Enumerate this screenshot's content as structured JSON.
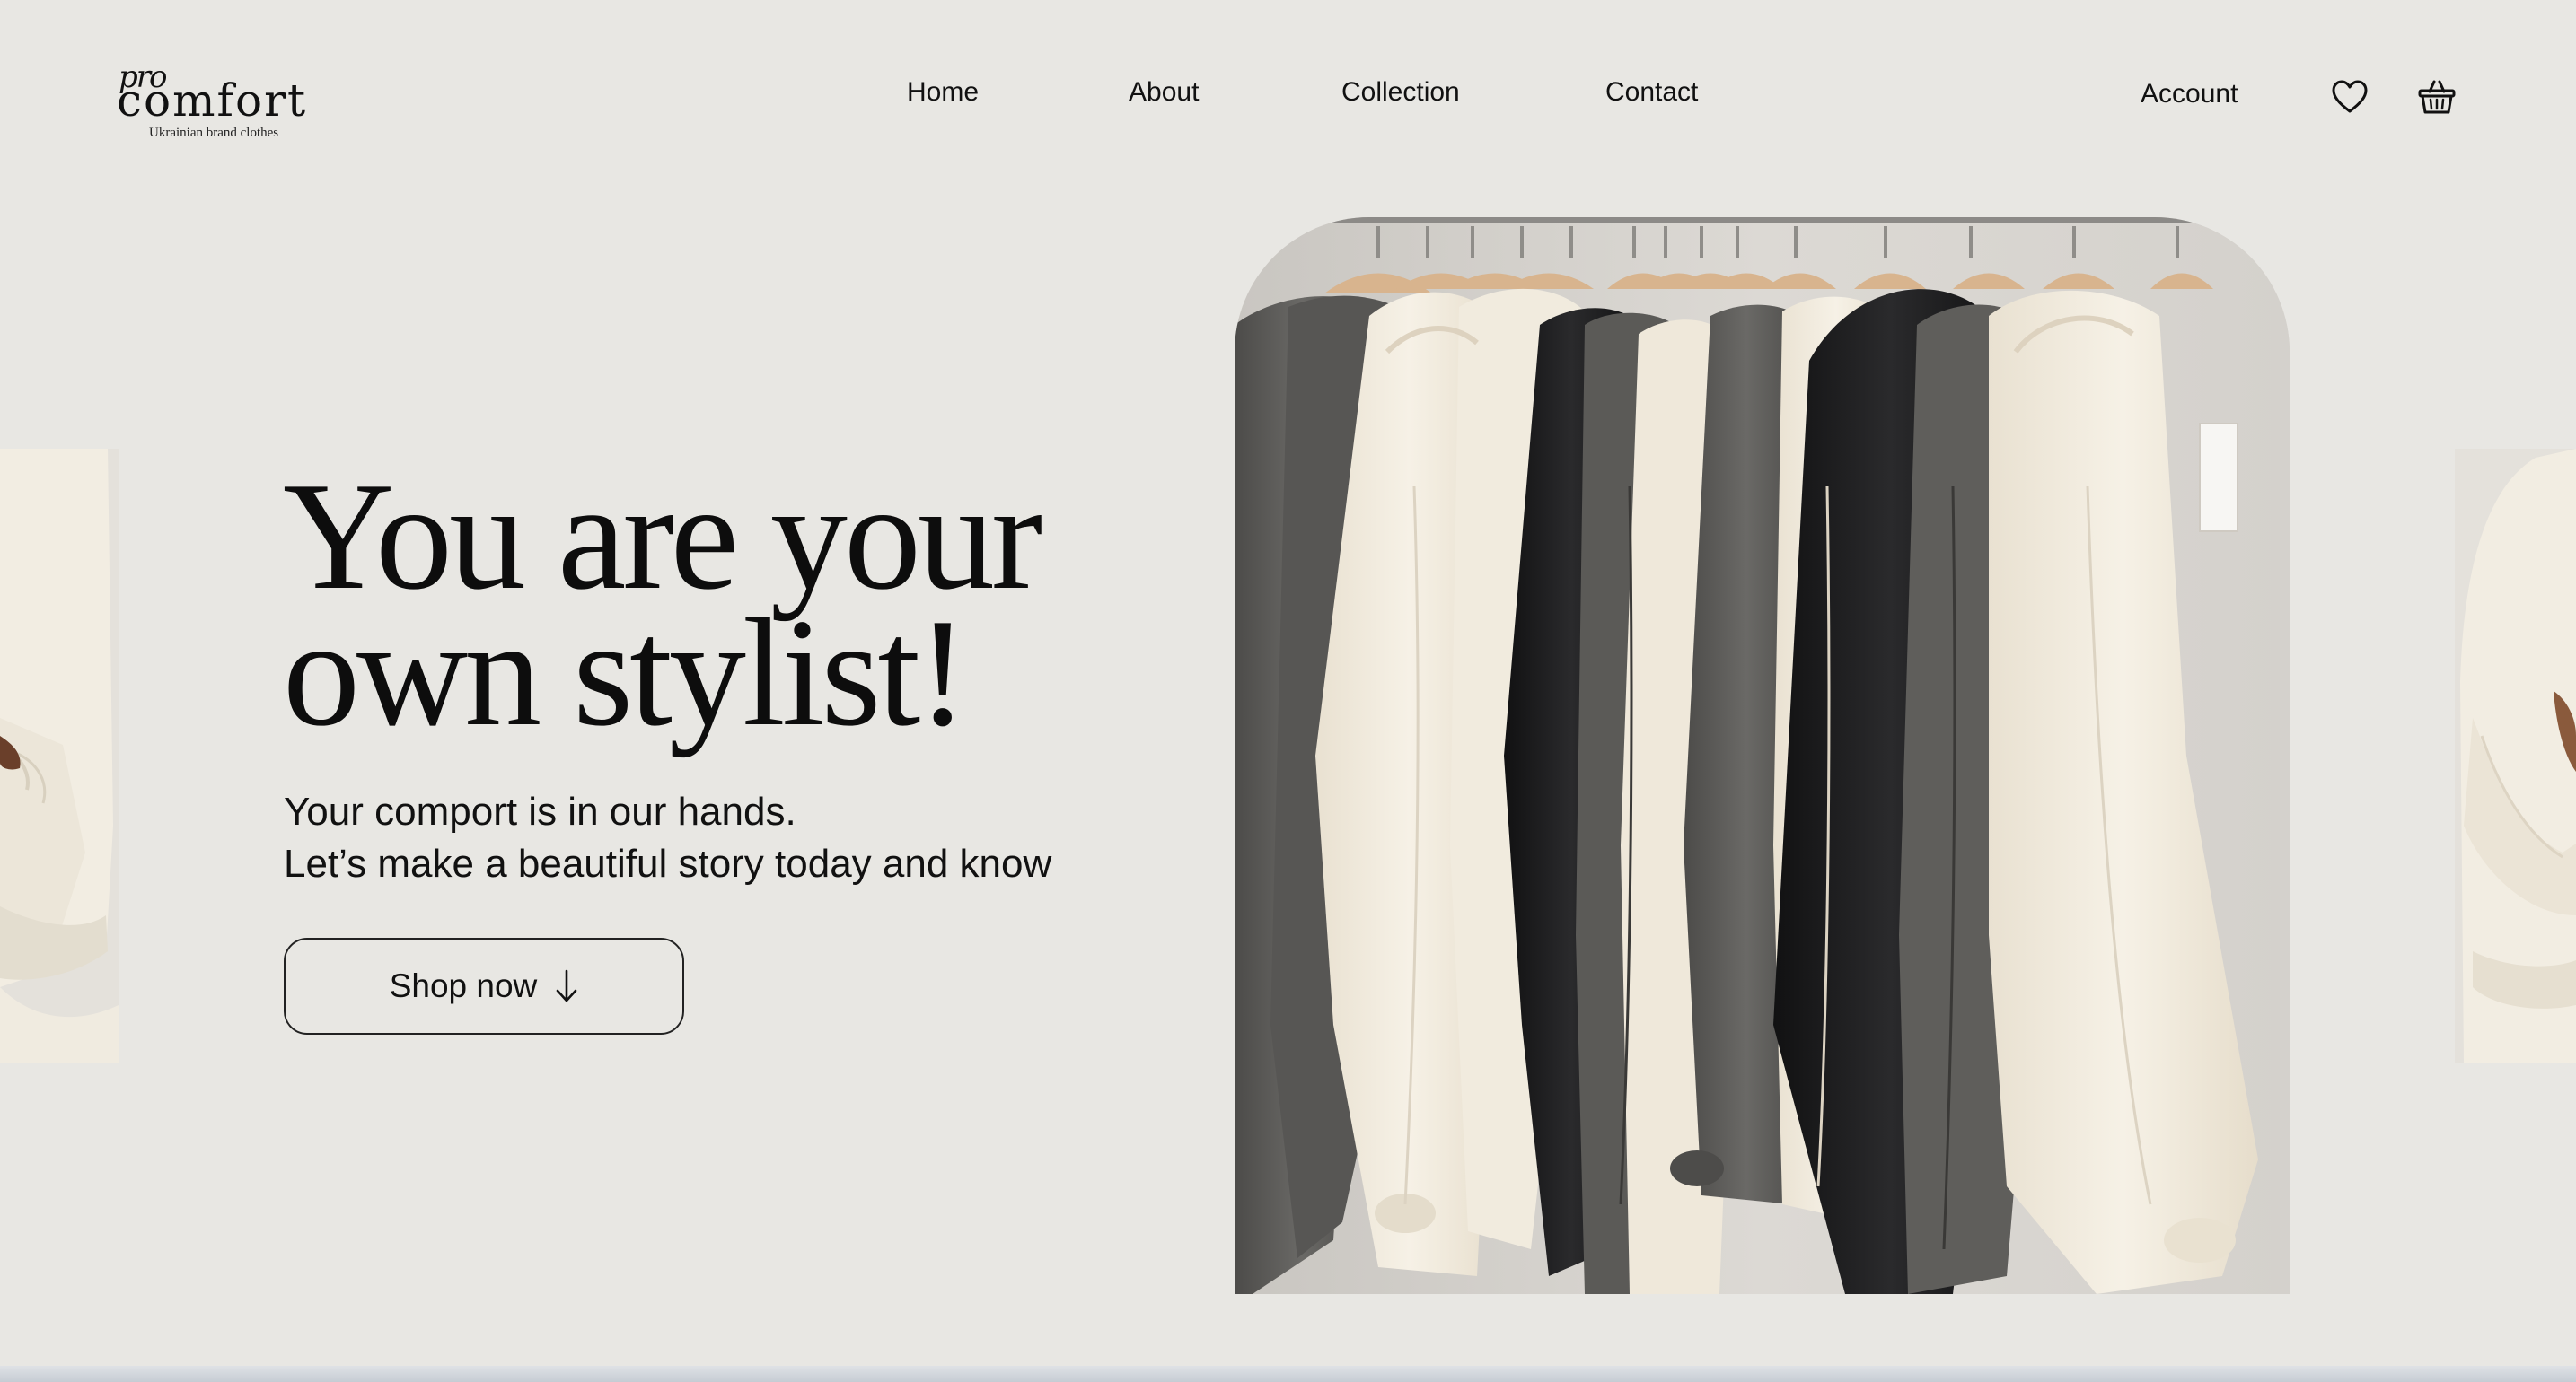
{
  "brand": {
    "logo_prefix": "pro",
    "logo_word": "comfort",
    "tagline": "Ukrainian brand clothes"
  },
  "nav": {
    "items": [
      {
        "label": "Home"
      },
      {
        "label": "About"
      },
      {
        "label": "Collection"
      },
      {
        "label": "Contact"
      }
    ]
  },
  "header_actions": {
    "account_label": "Account",
    "wishlist_icon": "heart-icon",
    "cart_icon": "basket-icon"
  },
  "hero": {
    "headline_line1": "You are your",
    "headline_line2": "own stylist!",
    "subtitle_line1": "Your comport is in our hands.",
    "subtitle_line2": "Let’s make a beautiful story today and know",
    "cta_label": "Shop now",
    "cta_icon": "arrow-down-icon"
  },
  "colors": {
    "background": "#e8e7e3",
    "text": "#111111",
    "garment_cream": "#f3ede1",
    "garment_charcoal": "#5e5d5b",
    "garment_black": "#1a1a1b"
  }
}
